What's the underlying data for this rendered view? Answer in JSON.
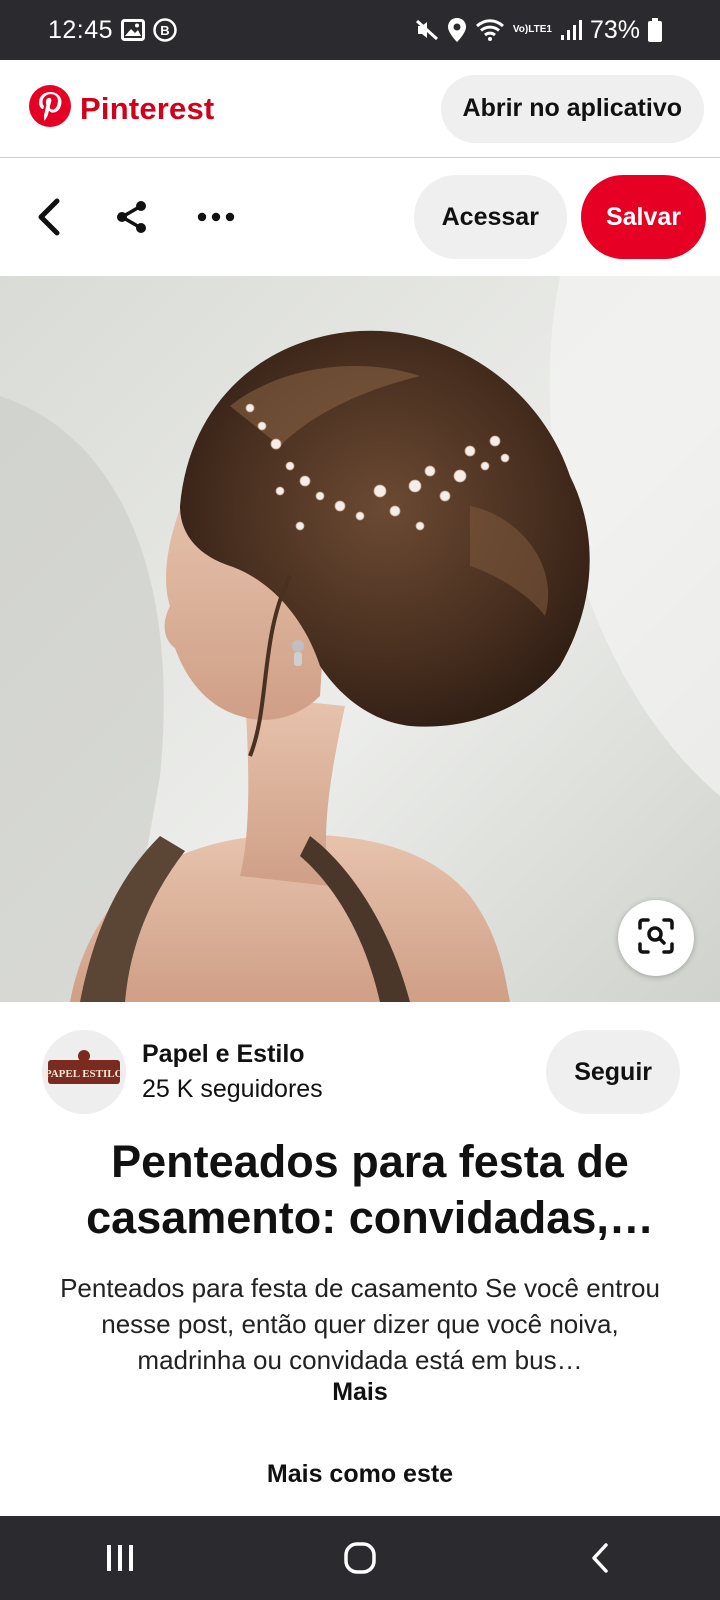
{
  "status_bar": {
    "time": "12:45",
    "battery": "73%",
    "network_label": "LTE1",
    "volte_label": "Vo)",
    "icons": [
      "image-icon",
      "b-circle-icon",
      "mute-icon",
      "location-icon",
      "wifi-icon",
      "signal-icon",
      "battery-icon"
    ]
  },
  "header": {
    "brand_name": "Pinterest",
    "open_app_label": "Abrir no aplicativo",
    "brand_color": "#e60023"
  },
  "toolbar": {
    "visit_label": "Acessar",
    "save_label": "Salvar"
  },
  "creator": {
    "name": "Papel e Estilo",
    "followers": "25 K seguidores",
    "follow_label": "Seguir",
    "avatar_text": "PAPEL ESTILO"
  },
  "pin": {
    "title": "Penteados para festa de casamento: convidadas,…",
    "description": "Penteados para festa de casamento Se você entrou nesse post, então quer dizer que você noiva, madrinha ou convidada está em bus…",
    "more_label": "Mais",
    "more_like_this": "Mais como este"
  }
}
